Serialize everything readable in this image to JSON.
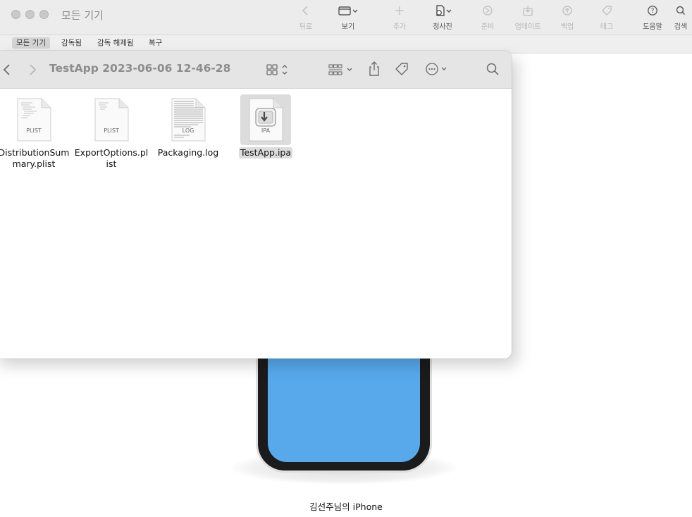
{
  "window": {
    "title": "모든 기기"
  },
  "toolbar": {
    "items": [
      {
        "label": "뒤로",
        "icon": "chevron-left-icon"
      },
      {
        "label": "보기",
        "icon": "view-icon"
      },
      {
        "label": "추가",
        "icon": "plus-icon"
      },
      {
        "label": "청사진",
        "icon": "blueprint-icon"
      },
      {
        "label": "준비",
        "icon": "prepare-icon"
      },
      {
        "label": "업데이트",
        "icon": "update-icon"
      },
      {
        "label": "백업",
        "icon": "backup-icon"
      },
      {
        "label": "태그",
        "icon": "tag-icon"
      },
      {
        "label": "도움말",
        "icon": "help-icon"
      },
      {
        "label": "검색",
        "icon": "search-icon"
      }
    ]
  },
  "tabs": [
    {
      "label": "모든 기기",
      "active": true
    },
    {
      "label": "감독됨",
      "active": false
    },
    {
      "label": "감독 해제됨",
      "active": false
    },
    {
      "label": "복구",
      "active": false
    }
  ],
  "device": {
    "name": "김선주님의 iPhone",
    "screen_color": "#57A9EC"
  },
  "finder": {
    "title": "TestApp 2023-06-06 12-46-28",
    "files": [
      {
        "name": "DistributionSummary.plist",
        "type_label": "PLIST",
        "selected": false
      },
      {
        "name": "ExportOptions.plist",
        "type_label": "PLIST",
        "selected": false
      },
      {
        "name": "Packaging.log",
        "type_label": "LOG",
        "selected": false
      },
      {
        "name": "TestApp.ipa",
        "type_label": "IPA",
        "selected": true
      }
    ]
  }
}
